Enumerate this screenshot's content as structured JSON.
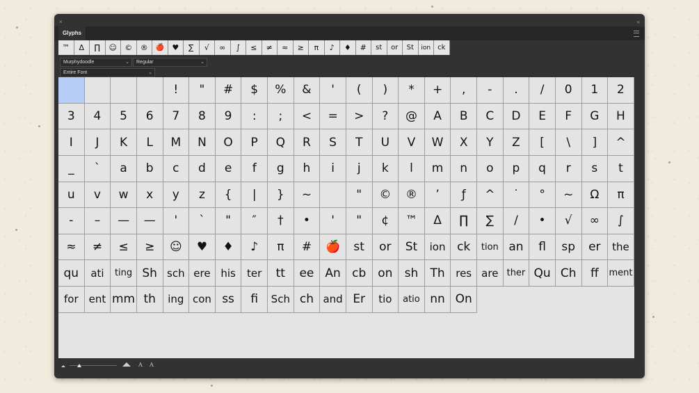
{
  "panel": {
    "title": "Glyphs",
    "close_glyph": "×",
    "collapse_glyph": "‹‹"
  },
  "recent_glyphs": [
    "™",
    "Δ",
    "∏",
    "☺",
    "©",
    "®",
    "🍎",
    "♥",
    "∑",
    "√",
    "∞",
    "∫",
    "≤",
    "≠",
    "≈",
    "≥",
    "π",
    "♪",
    "♦",
    "#",
    "st",
    "or",
    "St",
    "ion",
    "ck"
  ],
  "font": {
    "family": "Murphydoodle",
    "style": "Regular",
    "show": "Entire Font"
  },
  "glyphs": [
    "",
    "",
    "",
    "",
    "!",
    "\"",
    "#",
    "$",
    "%",
    "&",
    "'",
    "(",
    ")",
    "*",
    "+",
    ",",
    "-",
    ".",
    "/",
    "0",
    "1",
    "2",
    "3",
    "4",
    "5",
    "6",
    "7",
    "8",
    "9",
    ":",
    ";",
    "<",
    "=",
    ">",
    "?",
    "@",
    "A",
    "B",
    "C",
    "D",
    "E",
    "F",
    "G",
    "H",
    "I",
    "J",
    "K",
    "L",
    "M",
    "N",
    "O",
    "P",
    "Q",
    "R",
    "S",
    "T",
    "U",
    "V",
    "W",
    "X",
    "Y",
    "Z",
    "[",
    "\\",
    "]",
    "^",
    "_",
    "`",
    "a",
    "b",
    "c",
    "d",
    "e",
    "f",
    "g",
    "h",
    "i",
    "j",
    "k",
    "l",
    "m",
    "n",
    "o",
    "p",
    "q",
    "r",
    "s",
    "t",
    "u",
    "v",
    "w",
    "x",
    "y",
    "z",
    "{",
    "|",
    "}",
    "~",
    "",
    "\"",
    "©",
    "®",
    "’",
    "ƒ",
    "^",
    "˙",
    "°",
    "~",
    "Ω",
    "π",
    "-",
    "–",
    "—",
    "—",
    "'",
    "`",
    "\"",
    "″",
    "†",
    "•",
    "'",
    "\"",
    "¢",
    "™",
    "Δ",
    "∏",
    "∑",
    "/",
    "•",
    "√",
    "∞",
    "∫",
    "≈",
    "≠",
    "≤",
    "≥",
    "☺",
    "♥",
    "♦",
    "♪",
    "π",
    "#",
    "🍎",
    "st",
    "or",
    "St",
    "ion",
    "ck",
    "tion",
    "an",
    "fl",
    "sp",
    "er",
    "the",
    "qu",
    "ati",
    "ting",
    "Sh",
    "sch",
    "ere",
    "his",
    "ter",
    "tt",
    "ee",
    "An",
    "cb",
    "on",
    "sh",
    "Th",
    "res",
    "are",
    "ther",
    "Qu",
    "Ch",
    "ff",
    "ment",
    "for",
    "ent",
    "mm",
    "th",
    "ing",
    "con",
    "ss",
    "fi",
    "Sch",
    "ch",
    "and",
    "Er",
    "tio",
    "atio",
    "nn",
    "On"
  ],
  "footer": {
    "zoom_fraction": 0.2,
    "decrease_font_label": "A",
    "increase_font_label": "A"
  },
  "colors": {
    "panel": "#323232",
    "cell": "#e4e4e4",
    "selected": "#b6cdf7",
    "backdrop": "#f1ebdd"
  }
}
